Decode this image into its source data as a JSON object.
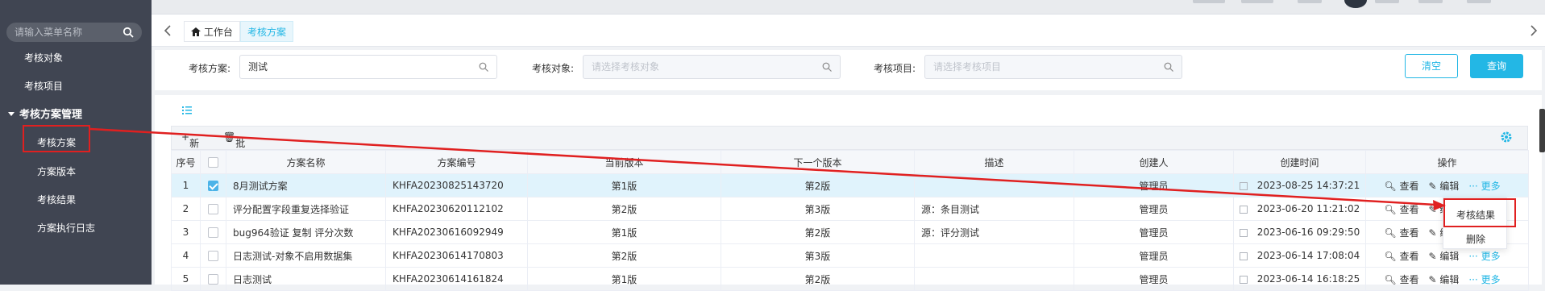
{
  "sidebar": {
    "search_placeholder": "请输入菜单名称",
    "items": [
      "考核对象",
      "考核项目"
    ],
    "group": "考核方案管理",
    "sub_items": [
      "考核方案",
      "方案版本",
      "考核结果",
      "方案执行日志"
    ]
  },
  "tabs": {
    "home": "工作台",
    "active": "考核方案"
  },
  "filter": {
    "plan_label": "考核方案:",
    "plan_value": "测试",
    "object_label": "考核对象:",
    "object_placeholder": "请选择考核对象",
    "item_label": "考核项目:",
    "item_placeholder": "请选择考核项目",
    "clear": "清空",
    "query": "查询"
  },
  "toolbar": {
    "add": "新增",
    "batch_delete": "批量删除"
  },
  "table": {
    "headers": [
      "序号",
      "",
      "方案名称",
      "方案编号",
      "当前版本",
      "下一个版本",
      "描述",
      "创建人",
      "创建时间",
      "操作"
    ],
    "rows": [
      {
        "no": "1",
        "name": "8月测试方案",
        "code": "KHFA20230825143720",
        "cur": "第1版",
        "next": "第2版",
        "desc": "",
        "creator": "管理员",
        "time": "2023-08-25 14:37:21",
        "checked": true
      },
      {
        "no": "2",
        "name": "评分配置字段重复选择验证",
        "code": "KHFA20230620112102",
        "cur": "第2版",
        "next": "第3版",
        "desc": "源：条目测试",
        "creator": "管理员",
        "time": "2023-06-20 11:21:02",
        "checked": false
      },
      {
        "no": "3",
        "name": "bug964验证 复制 评分次数",
        "code": "KHFA20230616092949",
        "cur": "第1版",
        "next": "第2版",
        "desc": "源：评分测试",
        "creator": "管理员",
        "time": "2023-06-16 09:29:50",
        "checked": false
      },
      {
        "no": "4",
        "name": "日志测试-对象不启用数据集",
        "code": "KHFA20230614170803",
        "cur": "第2版",
        "next": "第3版",
        "desc": "",
        "creator": "管理员",
        "time": "2023-06-14 17:08:04",
        "checked": false
      },
      {
        "no": "5",
        "name": "日志测试",
        "code": "KHFA20230614161824",
        "cur": "第1版",
        "next": "第2版",
        "desc": "",
        "creator": "管理员",
        "time": "2023-06-14 16:18:25",
        "checked": false
      }
    ],
    "op_view": "查看",
    "op_edit": "编辑",
    "op_more": "··· 更多"
  },
  "popup": {
    "result": "考核结果",
    "delete": "删除"
  },
  "colors": {
    "sidebar_bg": "#404552",
    "accent": "#23b7e5",
    "annotation_red": "#e02020",
    "selected_row": "#e0f3fc"
  }
}
